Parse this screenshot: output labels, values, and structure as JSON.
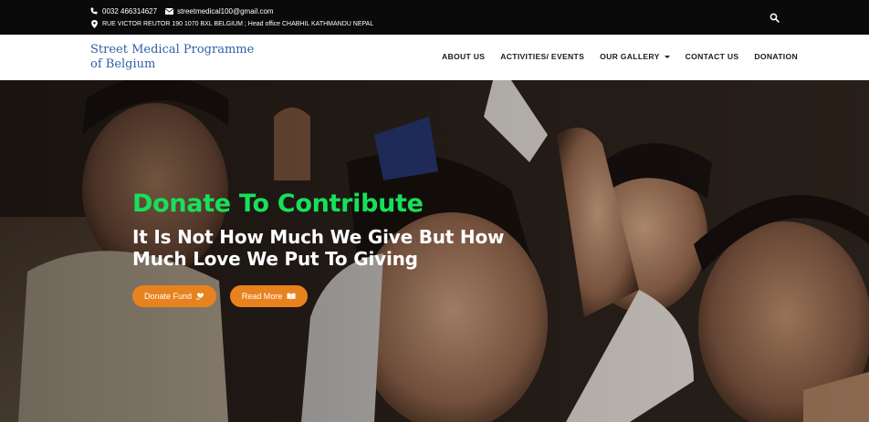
{
  "topbar": {
    "phone": "0032 466314627",
    "email": "streetmedical100@gmail.com",
    "address": "RUE VICTOR REUTOR 190 1070 BXL BELGIUM ; Head office CHABHIL KATHMANDU NEPAL",
    "phone_icon": "phone-icon",
    "email_icon": "envelope-icon",
    "address_icon": "map-marker-icon",
    "search_icon": "search-icon"
  },
  "header": {
    "brand": "Street Medical Programme of Belgium",
    "brand_color": "#2f5fa3",
    "nav": [
      {
        "label": "ABOUT US"
      },
      {
        "label": "ACTIVITIES/ EVENTS"
      },
      {
        "label": "OUR GALLERY",
        "dropdown": true
      },
      {
        "label": "CONTACT US"
      },
      {
        "label": "DONATION"
      }
    ]
  },
  "hero": {
    "title": "Donate To Contribute",
    "title_color": "#17e05b",
    "subtitle": "It Is Not How Much We Give But How Much Love We Put To Giving",
    "buttons": [
      {
        "label": "Donate Fund",
        "icon": "hand-heart-icon"
      },
      {
        "label": "Read More",
        "icon": "book-open-icon"
      }
    ],
    "button_color": "#e8821e"
  }
}
